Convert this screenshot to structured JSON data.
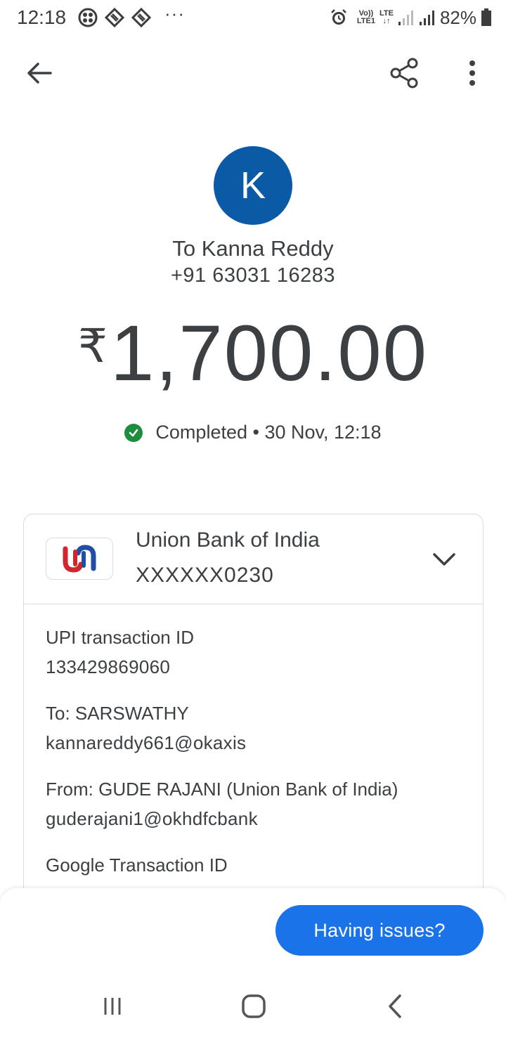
{
  "status_bar": {
    "time": "12:18",
    "dots": "···",
    "volte_top": "Vo))",
    "volte_bottom": "LTE1",
    "lte_top": "LTE",
    "lte_bottom": "↓↑",
    "battery": "82%"
  },
  "payee": {
    "initial": "K",
    "avatar_color": "#0b5aa6",
    "name": "To Kanna Reddy",
    "phone": "+91 63031 16283"
  },
  "amount": {
    "currency": "₹",
    "value": "1,700.00"
  },
  "status": {
    "text": "Completed • 30 Nov, 12:18",
    "color": "#1e8e3e"
  },
  "bank": {
    "name": "Union Bank of India",
    "account": "XXXXXX0230"
  },
  "details": {
    "upi_label": "UPI transaction ID",
    "upi_value": "133429869060",
    "to_label": "To: SARSWATHY",
    "to_value": "kannareddy661@okaxis",
    "from_label": "From: GUDE RAJANI (Union Bank of India)",
    "from_value": "guderajani1@okhdfcbank",
    "google_label": "Google Transaction ID"
  },
  "actions": {
    "issues_label": "Having issues?",
    "button_color": "#1a73e8"
  },
  "icons": {
    "back": "arrow-back-icon",
    "share": "share-icon",
    "more": "more-vert-icon",
    "expand": "chevron-down-icon",
    "nav_recents": "recents-icon",
    "nav_home": "home-icon",
    "nav_back": "nav-back-icon"
  }
}
